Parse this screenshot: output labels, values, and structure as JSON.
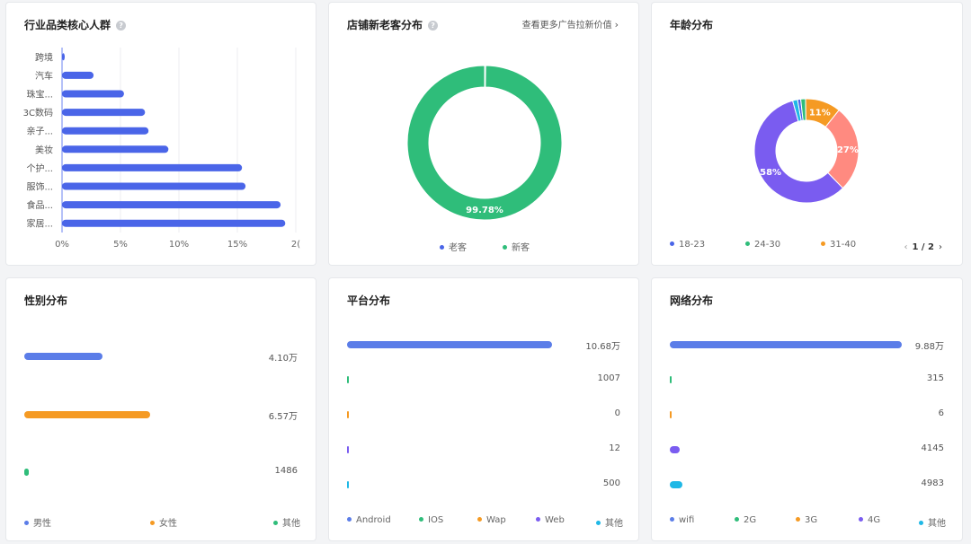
{
  "colors": {
    "blue": "#4a65e8",
    "green": "#2fbd7a",
    "orange": "#f59a23",
    "salmon": "#ff8a80",
    "purple": "#7a5cf0",
    "cyan": "#1fb8e6",
    "bar_blue": "#5b7de8"
  },
  "industry": {
    "title": "行业品类核心人群",
    "help_icon": "question-circle-icon",
    "chart_data": {
      "type": "bar",
      "orientation": "horizontal",
      "categories": [
        "跨境",
        "汽车",
        "珠宝...",
        "3C数码",
        "亲子...",
        "美妆",
        "个护...",
        "服饰...",
        "食品...",
        "家居..."
      ],
      "values": [
        0.2,
        2.7,
        5.3,
        7.1,
        7.4,
        9.1,
        15.4,
        15.7,
        18.7,
        19.1
      ],
      "xticks": [
        "0%",
        "5%",
        "10%",
        "15%",
        "2("
      ],
      "xlim": [
        0,
        20
      ],
      "grid": true
    }
  },
  "store": {
    "title": "店铺新老客分布",
    "help_icon": "question-circle-icon",
    "more_link": "查看更多广告拉新价值",
    "more_icon": "chevron-right-icon",
    "chart_data": {
      "type": "pie",
      "donut": true,
      "labels": [
        "老客",
        "新客"
      ],
      "values": [
        0.22,
        99.78
      ],
      "value_labels": [
        "0.22%",
        "99.78%"
      ],
      "colors": [
        "#4a65e8",
        "#2fbd7a"
      ]
    },
    "legend": [
      {
        "label": "老客",
        "color": "#4a65e8"
      },
      {
        "label": "新客",
        "color": "#2fbd7a"
      }
    ]
  },
  "age": {
    "title": "年龄分布",
    "chart_data": {
      "type": "pie",
      "donut": true,
      "labels": [
        "18-23",
        "24-30",
        "31-40",
        "",
        "",
        ""
      ],
      "values": [
        1,
        1.5,
        11,
        27,
        58,
        1.5
      ],
      "value_labels": [
        "",
        "",
        "11%",
        "27%",
        "58%",
        ""
      ],
      "colors": [
        "#4a65e8",
        "#2fbd7a",
        "#f59a23",
        "#ff8a80",
        "#7a5cf0",
        "#1fb8e6"
      ]
    },
    "legend": [
      {
        "label": "18-23",
        "color": "#4a65e8"
      },
      {
        "label": "24-30",
        "color": "#2fbd7a"
      },
      {
        "label": "31-40",
        "color": "#f59a23"
      }
    ],
    "pager": {
      "text": "1 / 2",
      "prev_icon": "chevron-left-icon",
      "next_icon": "chevron-right-icon"
    }
  },
  "gender": {
    "title": "性别分布",
    "chart_data": {
      "type": "bar",
      "orientation": "horizontal",
      "categories": [
        "男性",
        "女性",
        "其他"
      ],
      "values": [
        41000,
        65700,
        1486
      ],
      "value_labels": [
        "4.10万",
        "6.57万",
        "1486"
      ],
      "xlim": [
        0,
        105000
      ],
      "colors": [
        "#5b7de8",
        "#f59a23",
        "#2fbd7a"
      ]
    },
    "legend": [
      {
        "label": "男性",
        "color": "#5b7de8"
      },
      {
        "label": "女性",
        "color": "#f59a23"
      },
      {
        "label": "其他",
        "color": "#2fbd7a"
      }
    ]
  },
  "platform": {
    "title": "平台分布",
    "chart_data": {
      "type": "bar",
      "orientation": "horizontal",
      "categories": [
        "Android",
        "IOS",
        "Wap",
        "Web",
        "其他"
      ],
      "values": [
        106800,
        1007,
        0,
        12,
        500
      ],
      "value_labels": [
        "10.68万",
        "1007",
        "0",
        "12",
        "500"
      ],
      "xlim": [
        0,
        106800
      ],
      "colors": [
        "#5b7de8",
        "#2fbd7a",
        "#f59a23",
        "#7a5cf0",
        "#1fb8e6"
      ]
    },
    "legend": [
      {
        "label": "Android",
        "color": "#5b7de8"
      },
      {
        "label": "IOS",
        "color": "#2fbd7a"
      },
      {
        "label": "Wap",
        "color": "#f59a23"
      },
      {
        "label": "Web",
        "color": "#7a5cf0"
      },
      {
        "label": "其他",
        "color": "#1fb8e6"
      }
    ]
  },
  "network": {
    "title": "网络分布",
    "chart_data": {
      "type": "bar",
      "orientation": "horizontal",
      "categories": [
        "wifi",
        "2G",
        "3G",
        "4G",
        "其他"
      ],
      "values": [
        98800,
        315,
        6,
        4145,
        4983
      ],
      "value_labels": [
        "9.88万",
        "315",
        "6",
        "4145",
        "4983"
      ],
      "xlim": [
        0,
        98800
      ],
      "colors": [
        "#5b7de8",
        "#2fbd7a",
        "#f59a23",
        "#7a5cf0",
        "#1fb8e6"
      ]
    },
    "legend": [
      {
        "label": "wifi",
        "color": "#5b7de8"
      },
      {
        "label": "2G",
        "color": "#2fbd7a"
      },
      {
        "label": "3G",
        "color": "#f59a23"
      },
      {
        "label": "4G",
        "color": "#7a5cf0"
      },
      {
        "label": "其他",
        "color": "#1fb8e6"
      }
    ]
  }
}
